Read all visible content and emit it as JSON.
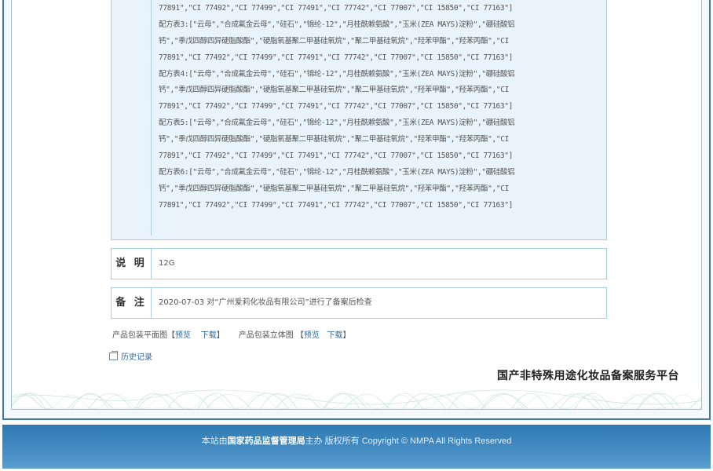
{
  "formula_lines": [
    "77891\",\"CI 77492\",\"CI 77499\",\"CI 77491\",\"CI 77742\",\"CI 77007\",\"CI 15850\",\"CI 77163\"]",
    "配方表3:[\"云母\",\"合成氟金云母\",\"硅石\",\"锦纶-12\",\"月桂酰赖氨酸\",\"玉米(ZEA MAYS)淀粉\",\"硼硅酸铝",
    "钙\",\"季戊四醇四异硬脂酸酯\",\"硬脂氧基聚二甲基硅氧烷\",\"聚二甲基硅氧烷\",\"羟苯甲酯\",\"羟苯丙酯\",\"CI",
    "77891\",\"CI 77492\",\"CI 77499\",\"CI 77491\",\"CI 77742\",\"CI 77007\",\"CI 15850\",\"CI 77163\"]",
    "配方表4:[\"云母\",\"合成氟金云母\",\"硅石\",\"锦纶-12\",\"月桂酰赖氨酸\",\"玉米(ZEA MAYS)淀粉\",\"硼硅酸铝",
    "钙\",\"季戊四醇四异硬脂酸酯\",\"硬脂氧基聚二甲基硅氧烷\",\"聚二甲基硅氧烷\",\"羟苯甲酯\",\"羟苯丙酯\",\"CI",
    "77891\",\"CI 77492\",\"CI 77499\",\"CI 77491\",\"CI 77742\",\"CI 77007\",\"CI 15850\",\"CI 77163\"]",
    "配方表5:[\"云母\",\"合成氟金云母\",\"硅石\",\"锦纶-12\",\"月桂酰赖氨酸\",\"玉米(ZEA MAYS)淀粉\",\"硼硅酸铝",
    "钙\",\"季戊四醇四异硬脂酸酯\",\"硬脂氧基聚二甲基硅氧烷\",\"聚二甲基硅氧烷\",\"羟苯甲酯\",\"羟苯丙酯\",\"CI",
    "77891\",\"CI 77492\",\"CI 77499\",\"CI 77491\",\"CI 77742\",\"CI 77007\",\"CI 15850\",\"CI 77163\"]",
    "配方表6:[\"云母\",\"合成氟金云母\",\"硅石\",\"锦纶-12\",\"月桂酰赖氨酸\",\"玉米(ZEA MAYS)淀粉\",\"硼硅酸铝",
    "钙\",\"季戊四醇四异硬脂酸酯\",\"硬脂氧基聚二甲基硅氧烷\",\"聚二甲基硅氧烷\",\"羟苯甲酯\",\"羟苯丙酯\",\"CI",
    "77891\",\"CI 77492\",\"CI 77499\",\"CI 77491\",\"CI 77742\",\"CI 77007\",\"CI 15850\",\"CI 77163\"]"
  ],
  "description": {
    "label": "说 明",
    "value": "12G"
  },
  "remarks": {
    "label": "备 注",
    "value": "2020-07-03 对“广州爱莉化妆品有限公司”进行了备案后检查"
  },
  "packaging": {
    "flat_label": "产品包装平面图【",
    "flat_preview": "预览",
    "flat_download": "下载",
    "flat_close": "】",
    "stereo_label": "产品包装立体图 【",
    "stereo_preview": "预览",
    "stereo_download": "下载",
    "stereo_close": "】"
  },
  "history_link": "历史记录",
  "platform_title": "国产非特殊用途化妆品备案服务平台",
  "footer": {
    "prefix": "本站由",
    "org": "国家药品监督管理局",
    "suffix": "主办 版权所有 Copyright © NMPA All Rights Reserved"
  },
  "colors": {
    "accent": "#3f7ba3",
    "link": "#2a6aa8",
    "footer_bg": "#3f88c0",
    "formula_bg": "#e8f3fb"
  }
}
